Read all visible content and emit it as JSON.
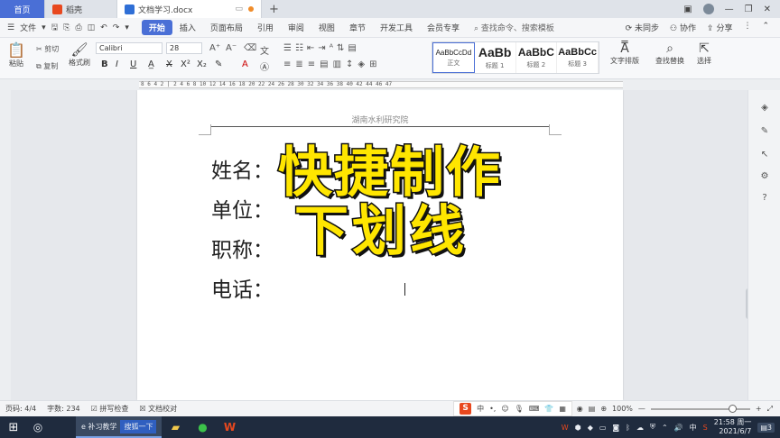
{
  "tabs": {
    "home": "首页",
    "docer": "稻壳",
    "document": "文档学习.docx",
    "add": "+"
  },
  "menu": {
    "file": "文件",
    "items": [
      "开始",
      "插入",
      "页面布局",
      "引用",
      "审阅",
      "视图",
      "章节",
      "开发工具",
      "会员专享"
    ],
    "search": "查找命令、搜索模板",
    "unsynced": "未同步",
    "collab": "协作",
    "share": "分享"
  },
  "ribbon": {
    "cut": "剪切",
    "copy": "复制",
    "paste": "粘贴",
    "format_painter": "格式刷",
    "font_name": "Calibri",
    "font_size": "28",
    "styles": [
      {
        "preview": "AaBbCcDd",
        "label": "正文"
      },
      {
        "preview": "AaBb",
        "label": "标题 1"
      },
      {
        "preview": "AaBbC",
        "label": "标题 2"
      },
      {
        "preview": "AaBbCc",
        "label": "标题 3"
      }
    ],
    "text_layout": "文字排版",
    "find_replace": "查找替换",
    "select": "选择"
  },
  "ruler": {
    "numbers": "8 6 4 2 | 2 4 6 8 10 12 14 16 18 20 22 24 26 28 30 32 34 36 38 40 42 44 46 47"
  },
  "document": {
    "header": "湖南水利研究院",
    "fields": [
      "姓名：",
      "单位：",
      "职称：",
      "电话："
    ]
  },
  "overlay": {
    "line1": "快捷制作",
    "line2": "下划线"
  },
  "status": {
    "page": "页码: 4/4",
    "words": "字数: 234",
    "spell": "拼写检查",
    "proof": "文档校对",
    "ime_lang": "中",
    "zoom": "100%"
  },
  "taskbar": {
    "browser_label": "e 补习教学",
    "browser_tab": "搜狐一下",
    "ime": "中",
    "time": "21:58 周一",
    "date": "2021/6/7",
    "notif": "3"
  }
}
